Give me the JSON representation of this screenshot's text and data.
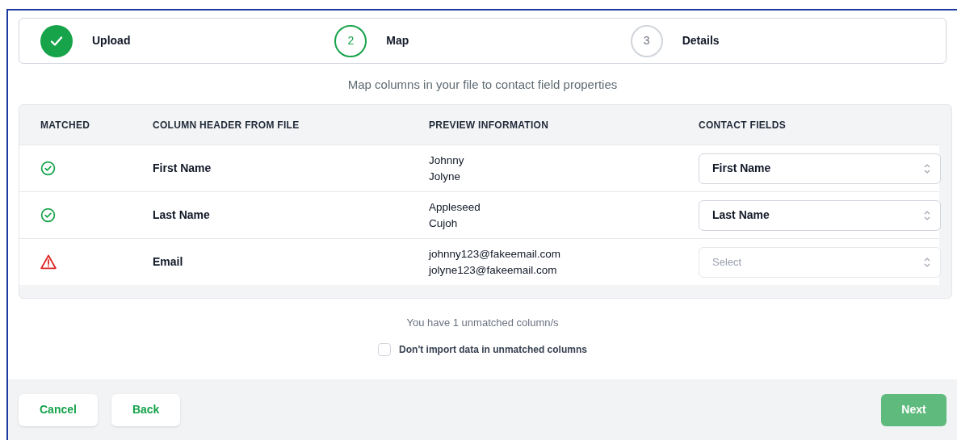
{
  "steps": [
    {
      "label": "Upload",
      "completed": true,
      "selected": false
    },
    {
      "number": "2",
      "label": "Map",
      "completed": false,
      "selected": true
    },
    {
      "number": "3",
      "label": "Details",
      "completed": false,
      "selected": false
    }
  ],
  "subtitle": "Map columns in your file to contact field properties",
  "table": {
    "columns": [
      "MATCHED",
      "COLUMN HEADER FROM FILE",
      "PREVIEW INFORMATION",
      "CONTACT FIELDS"
    ],
    "rows": [
      {
        "matched": true,
        "header": "First Name",
        "preview": [
          "Johnny",
          "Jolyne"
        ],
        "field": {
          "value": "First Name"
        }
      },
      {
        "matched": true,
        "header": "Last Name",
        "preview": [
          "Appleseed",
          "Cujoh"
        ],
        "field": {
          "value": "Last Name"
        }
      },
      {
        "matched": false,
        "header": "Email",
        "preview": [
          "johnny123@fakeemail.com",
          "jolyne123@fakeemail.com"
        ],
        "field": {
          "placeholder": "Select"
        }
      }
    ]
  },
  "unmatched_note": "You have 1 unmatched column/s",
  "skip_checkbox": {
    "label": "Don't import data in unmatched columns",
    "checked": false
  },
  "buttons": [
    {
      "label": "Cancel",
      "kind": "secondary"
    },
    {
      "label": "Back",
      "kind": "secondary"
    },
    {
      "label": "Next",
      "kind": "primary",
      "disabled": true
    }
  ]
}
